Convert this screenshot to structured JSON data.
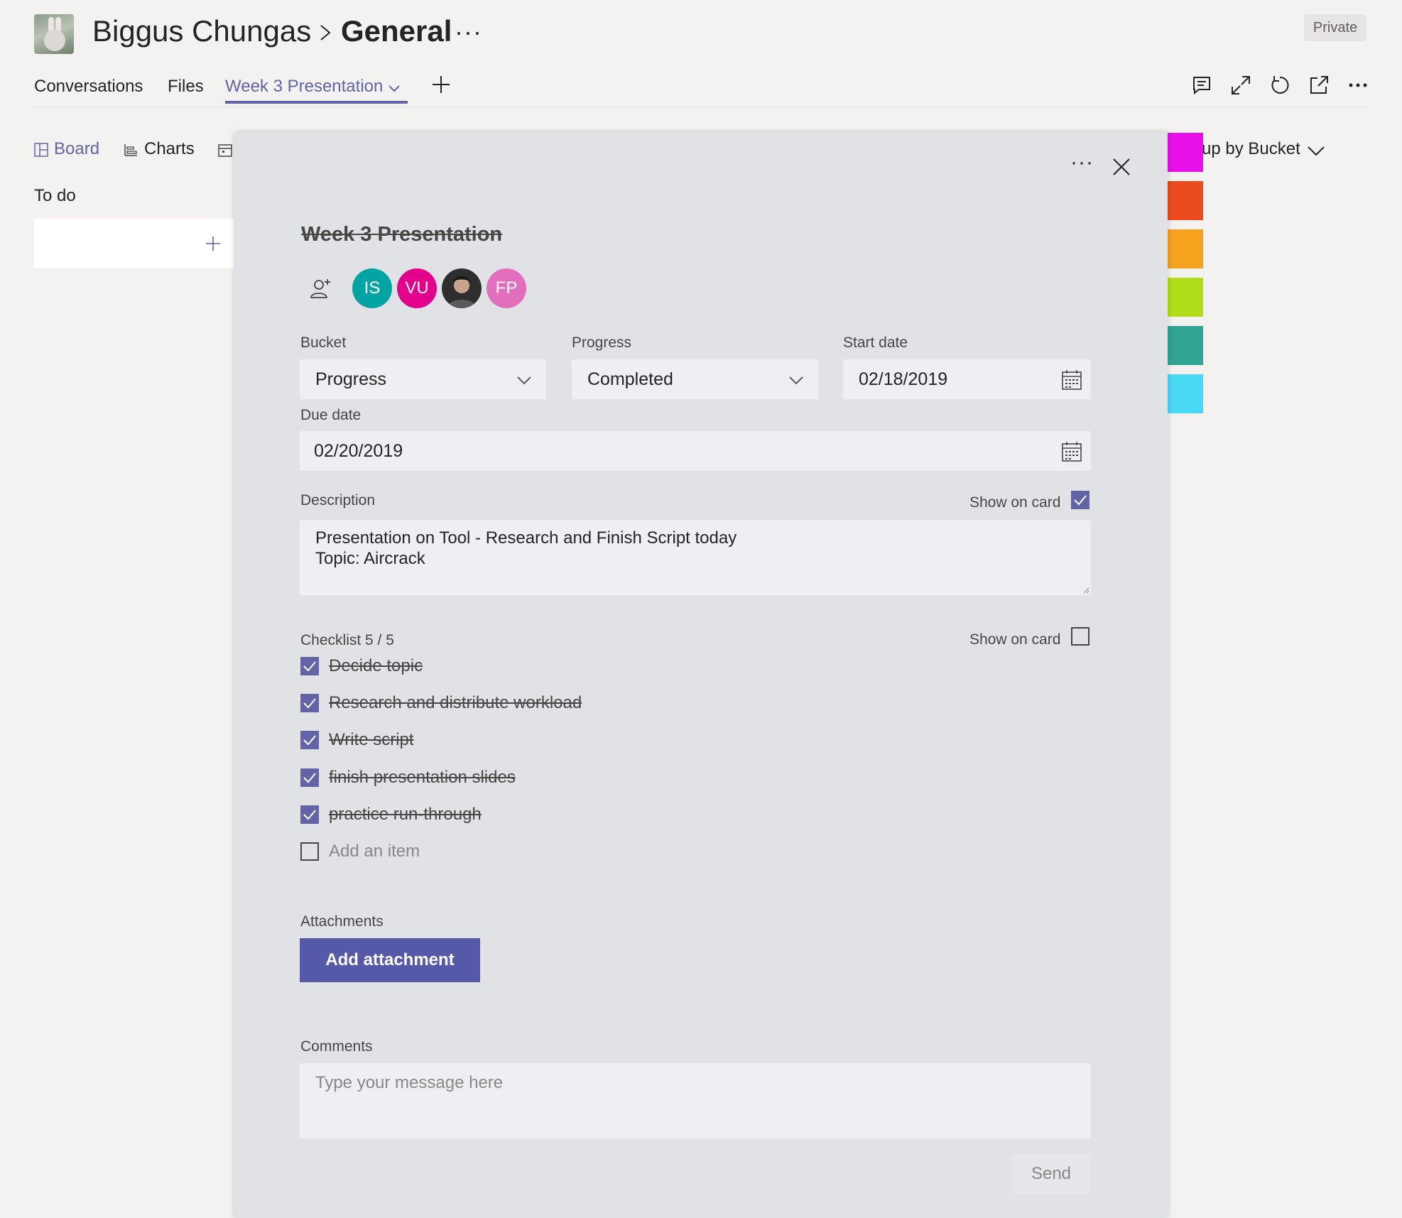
{
  "header": {
    "team_name": "Biggus Chungas",
    "channel_name": "General",
    "more": "···",
    "visibility_badge": "Private"
  },
  "tabs": [
    {
      "label": "Conversations"
    },
    {
      "label": "Files"
    },
    {
      "label": "Week 3 Presentation",
      "active": true
    }
  ],
  "toolbar_icons": [
    "conversation-icon",
    "expand-icon",
    "refresh-icon",
    "popout-icon",
    "more-icon"
  ],
  "board": {
    "views": [
      {
        "label": "Board",
        "active": true
      },
      {
        "label": "Charts"
      }
    ],
    "column_title": "To do",
    "group_by_label": "up by Bucket",
    "label_colors": [
      "#e810e8",
      "#ec4b20",
      "#f5a31f",
      "#b2dd1b",
      "#31a493",
      "#4ad9f5"
    ]
  },
  "task": {
    "title": "Week 3 Presentation",
    "assignees": [
      {
        "initials": "IS",
        "color": "#00a5a3"
      },
      {
        "initials": "VU",
        "color": "#e3008c"
      },
      {
        "initials": "",
        "color": "#2e2e2e",
        "photo": true
      },
      {
        "initials": "FP",
        "color": "#e26fbe"
      }
    ],
    "bucket": {
      "label": "Bucket",
      "value": "Progress"
    },
    "progress": {
      "label": "Progress",
      "value": "Completed"
    },
    "start_date": {
      "label": "Start date",
      "value": "02/18/2019"
    },
    "due_date": {
      "label": "Due date",
      "value": "02/20/2019"
    },
    "description": {
      "label": "Description",
      "show_on_card_label": "Show on card",
      "show_on_card": true,
      "lines": [
        "Presentation on Tool - Research and Finish Script today",
        "Topic: Aircrack"
      ]
    },
    "checklist": {
      "label": "Checklist 5 / 5",
      "show_on_card_label": "Show on card",
      "show_on_card": false,
      "items": [
        {
          "text": "Decide topic",
          "checked": true
        },
        {
          "text": "Research and distribute workload",
          "checked": true
        },
        {
          "text": "Write script",
          "checked": true
        },
        {
          "text": "finish presentation slides",
          "checked": true
        },
        {
          "text": "practice run-through",
          "checked": true
        }
      ],
      "add_item_placeholder": "Add an item"
    },
    "attachments": {
      "label": "Attachments",
      "button": "Add attachment"
    },
    "comments": {
      "label": "Comments",
      "placeholder": "Type your message here",
      "send": "Send"
    },
    "more": "···"
  }
}
